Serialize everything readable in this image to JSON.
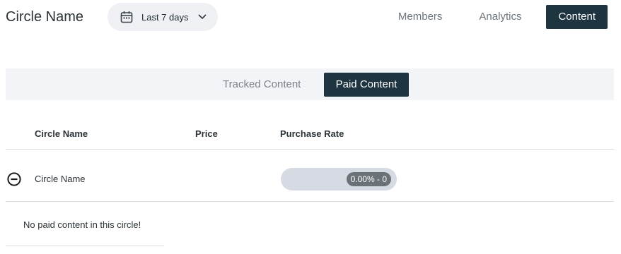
{
  "header": {
    "title": "Circle Name",
    "date_range": {
      "label": "Last 7 days",
      "icon": "calendar-icon",
      "chevron": "chevron-down-icon"
    },
    "nav": {
      "members": "Members",
      "analytics": "Analytics",
      "content": "Content"
    }
  },
  "tabs": {
    "tracked": "Tracked Content",
    "paid": "Paid Content",
    "active": "paid"
  },
  "table": {
    "columns": {
      "name": "Circle Name",
      "price": "Price",
      "purchase_rate": "Purchase Rate"
    },
    "rows": [
      {
        "name": "Circle Name",
        "price": "",
        "purchase_rate_label": "0.00% - 0",
        "purchase_rate_fraction": 0,
        "toggle_icon": "minus-circle-icon"
      }
    ]
  },
  "empty_state": "No paid content in this circle!",
  "colors": {
    "accent": "#1e3440",
    "tab_bar_bg": "#f2f4f7",
    "date_picker_bg": "#eef0f3",
    "rate_bar_bg": "#d6dae3",
    "rate_badge_bg": "#6b7277"
  }
}
